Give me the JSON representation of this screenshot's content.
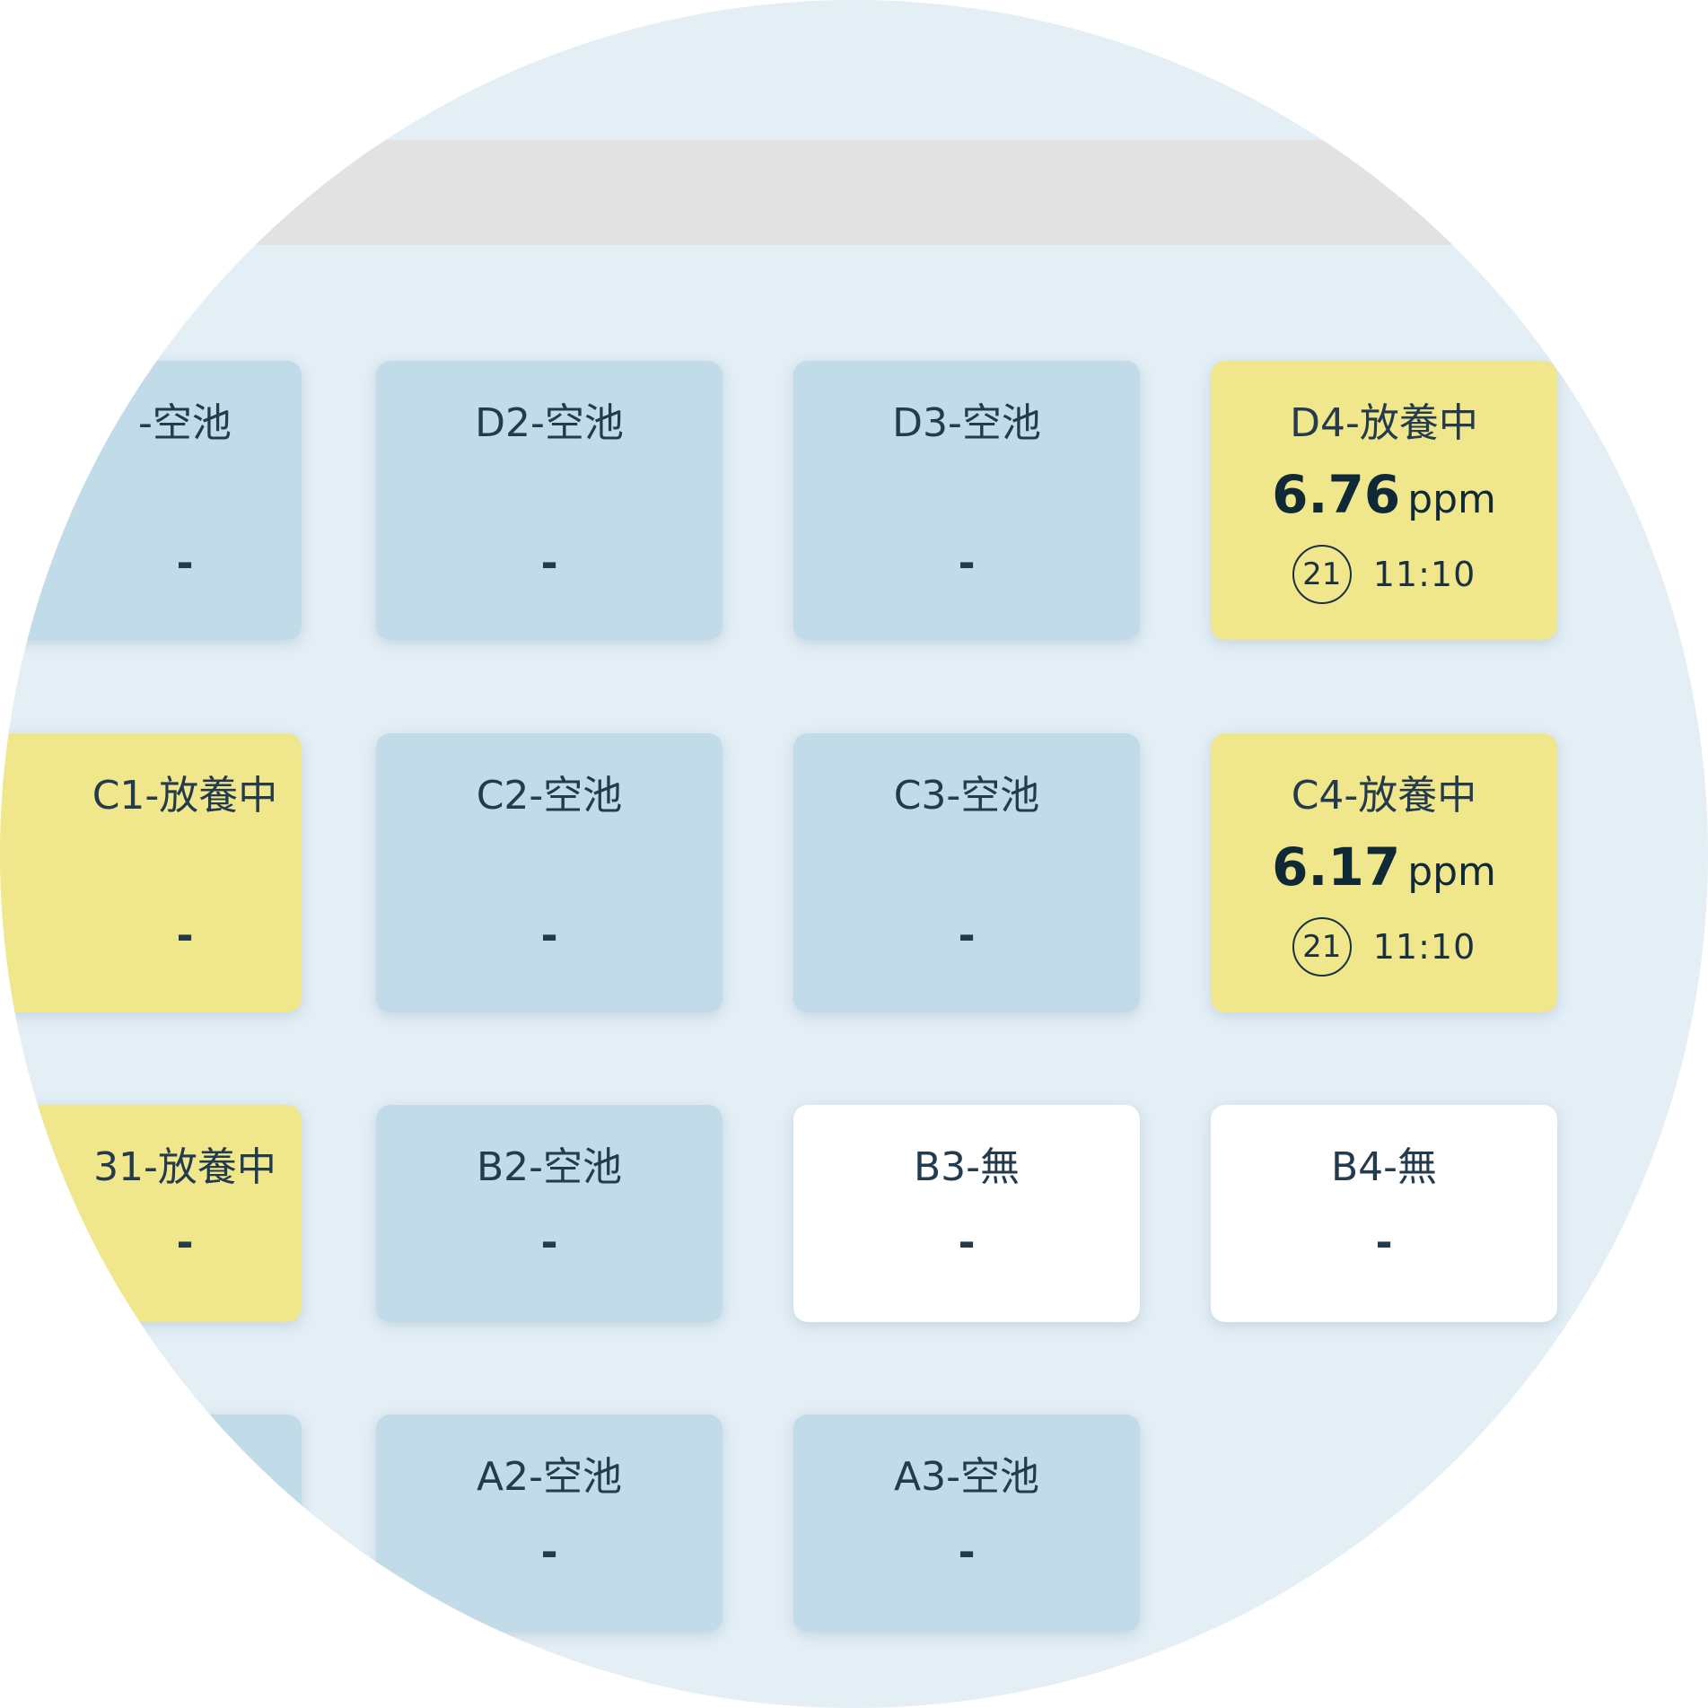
{
  "colors": {
    "background": "#e3eef5",
    "header_bar": "#e2e2e2",
    "empty_pond": "#c1dbe9",
    "stocked_pond": "#f0e68c",
    "no_pond": "#ffffff",
    "text": "#243a4d"
  },
  "ponds": {
    "D1": {
      "label": "-空池",
      "status": "empty",
      "placeholder": "-"
    },
    "D2": {
      "label": "D2-空池",
      "status": "empty",
      "placeholder": "-"
    },
    "D3": {
      "label": "D3-空池",
      "status": "empty",
      "placeholder": "-"
    },
    "D4": {
      "label": "D4-放養中",
      "status": "stocked",
      "value": "6.76",
      "unit": "ppm",
      "day": "21",
      "time": "11:10"
    },
    "C1": {
      "label": "C1-放養中",
      "status": "stocked",
      "placeholder": "-"
    },
    "C2": {
      "label": "C2-空池",
      "status": "empty",
      "placeholder": "-"
    },
    "C3": {
      "label": "C3-空池",
      "status": "empty",
      "placeholder": "-"
    },
    "C4": {
      "label": "C4-放養中",
      "status": "stocked",
      "value": "6.17",
      "unit": "ppm",
      "day": "21",
      "time": "11:10"
    },
    "B1": {
      "label": "31-放養中",
      "status": "stocked",
      "placeholder": "-"
    },
    "B2": {
      "label": "B2-空池",
      "status": "empty",
      "placeholder": "-"
    },
    "B3": {
      "label": "B3-無",
      "status": "none",
      "placeholder": "-"
    },
    "B4": {
      "label": "B4-無",
      "status": "none",
      "placeholder": "-"
    },
    "A1": {
      "label": "",
      "status": "empty"
    },
    "A2": {
      "label": "A2-空池",
      "status": "empty",
      "placeholder": "-"
    },
    "A3": {
      "label": "A3-空池",
      "status": "empty",
      "placeholder": "-"
    }
  }
}
